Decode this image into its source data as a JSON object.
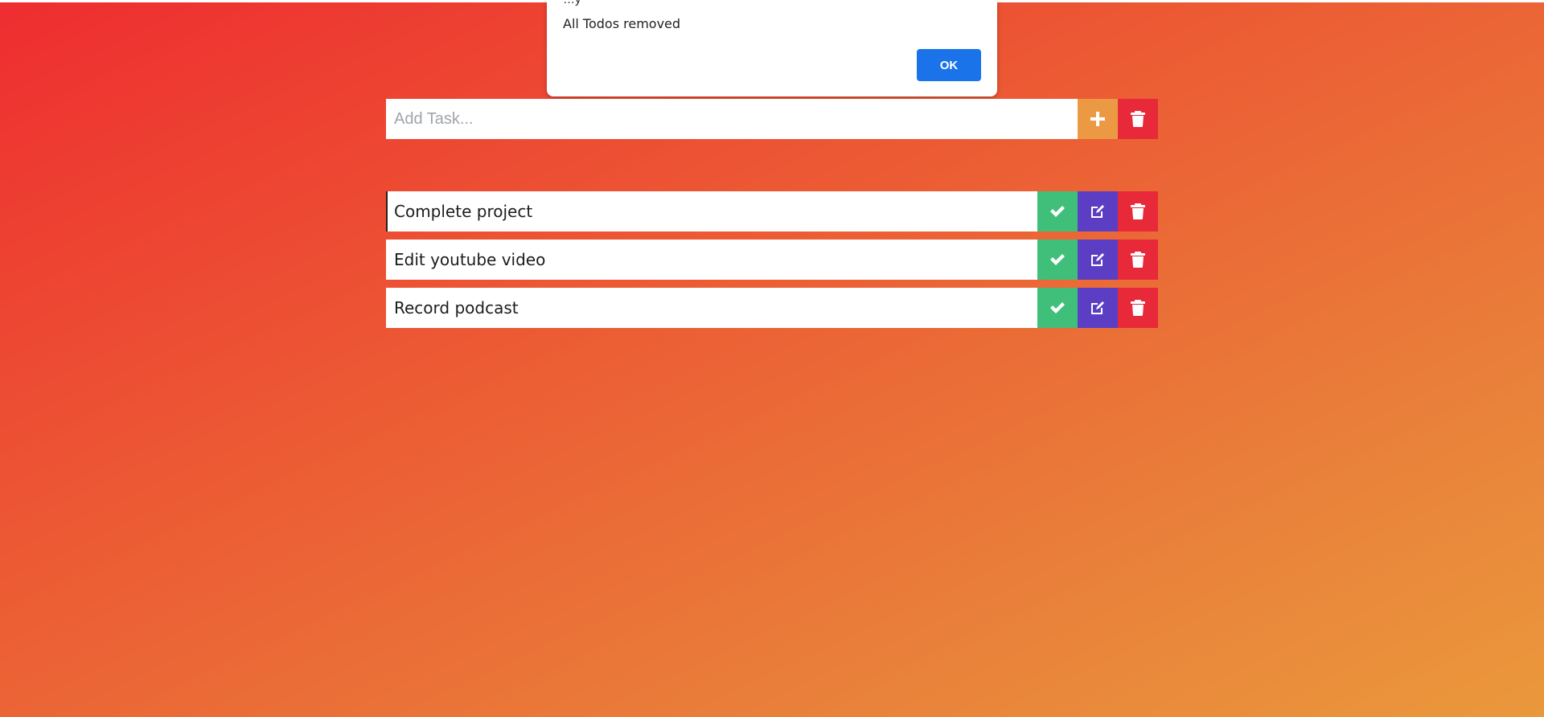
{
  "dialog": {
    "origin_text": "…y",
    "message": "All Todos removed",
    "ok_label": "OK"
  },
  "add_task": {
    "placeholder": "Add Task...",
    "add_icon": "plus-icon",
    "clear_icon": "trash-icon"
  },
  "todos": [
    {
      "text": "Complete project"
    },
    {
      "text": "Edit youtube video"
    },
    {
      "text": "Record podcast"
    }
  ],
  "colors": {
    "add": "#eb9a43",
    "delete": "#e7293a",
    "complete": "#3fbf7a",
    "edit": "#5b3ec4",
    "dialog_ok": "#1a73e8"
  },
  "icons": {
    "complete": "check-icon",
    "edit": "edit-icon",
    "delete": "trash-icon"
  }
}
